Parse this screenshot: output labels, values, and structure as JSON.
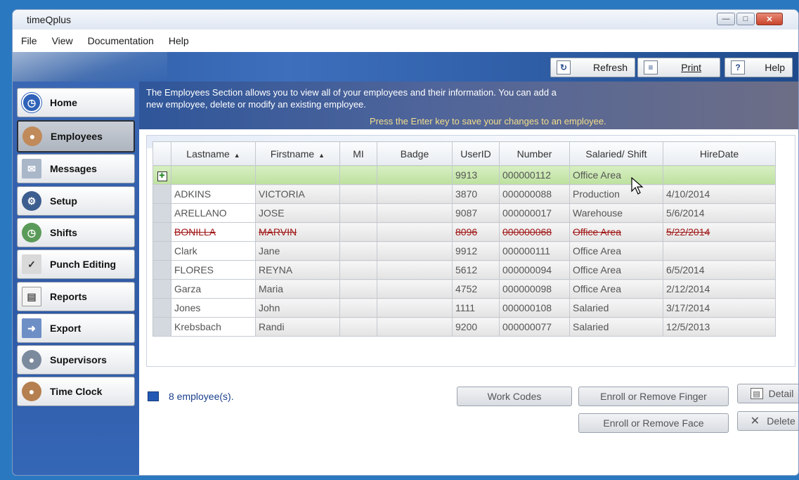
{
  "window": {
    "title": "timeQplus"
  },
  "menu": [
    "File",
    "View",
    "Documentation",
    "Help"
  ],
  "toolbar": {
    "refresh": "Refresh",
    "print": "Print",
    "help": "Help"
  },
  "sidebar": {
    "items": [
      {
        "label": "Home",
        "icon": "clock-icon",
        "active": false
      },
      {
        "label": "Employees",
        "icon": "person-icon",
        "active": true
      },
      {
        "label": "Messages",
        "icon": "envelope-icon",
        "active": false
      },
      {
        "label": "Setup",
        "icon": "gear-icon",
        "active": false
      },
      {
        "label": "Shifts",
        "icon": "shift-clock-icon",
        "active": false
      },
      {
        "label": "Punch Editing",
        "icon": "check-pencil-icon",
        "active": false
      },
      {
        "label": "Reports",
        "icon": "document-icon",
        "active": false
      },
      {
        "label": "Export",
        "icon": "export-arrow-icon",
        "active": false
      },
      {
        "label": "Supervisors",
        "icon": "people-icon",
        "active": false
      },
      {
        "label": "Time Clock",
        "icon": "time-clock-person-icon",
        "active": false
      }
    ]
  },
  "info": {
    "line1": "The Employees Section allows you to view all of your employees and their information.  You can add a",
    "line2": "new employee, delete or modify an existing employee.",
    "enter_hint": "Press the Enter key to save your changes to an employee."
  },
  "grid": {
    "columns": [
      "Lastname",
      "Firstname",
      "MI",
      "Badge",
      "UserID",
      "Number",
      "Salaried/ Shift",
      "HireDate"
    ],
    "rows": [
      {
        "state": "new",
        "cells": [
          "",
          "",
          "",
          "",
          "9913",
          "000000112",
          "Office Area",
          ""
        ]
      },
      {
        "state": "normal",
        "cells": [
          "ADKINS",
          "VICTORIA",
          "",
          "",
          "3870",
          "000000088",
          "Production",
          "4/10/2014"
        ]
      },
      {
        "state": "normal",
        "cells": [
          "ARELLANO",
          "JOSE",
          "",
          "",
          "9087",
          "000000017",
          "Warehouse",
          "5/6/2014"
        ]
      },
      {
        "state": "deleted",
        "cells": [
          "BONILLA",
          "MARVIN",
          "",
          "",
          "8096",
          "000000068",
          "Office Area",
          "5/22/2014"
        ]
      },
      {
        "state": "normal",
        "cells": [
          "Clark",
          "Jane",
          "",
          "",
          "9912",
          "000000111",
          "Office Area",
          ""
        ]
      },
      {
        "state": "normal",
        "cells": [
          "FLORES",
          "REYNA",
          "",
          "",
          "5612",
          "000000094",
          "Office Area",
          "6/5/2014"
        ]
      },
      {
        "state": "normal",
        "cells": [
          "Garza",
          "Maria",
          "",
          "",
          "4752",
          "000000098",
          "Office Area",
          "2/12/2014"
        ]
      },
      {
        "state": "normal",
        "cells": [
          "Jones",
          "John",
          "",
          "",
          "1111",
          "000000108",
          "Salaried",
          "3/17/2014"
        ]
      },
      {
        "state": "normal",
        "cells": [
          "Krebsbach",
          "Randi",
          "",
          "",
          "9200",
          "000000077",
          "Salaried",
          "12/5/2013"
        ]
      }
    ]
  },
  "footer": {
    "count": "8 employee(s).",
    "work_codes": "Work Codes",
    "enroll_finger": "Enroll or Remove Finger",
    "enroll_face": "Enroll or Remove Face",
    "detail": "Detail",
    "delete": "Delete"
  }
}
